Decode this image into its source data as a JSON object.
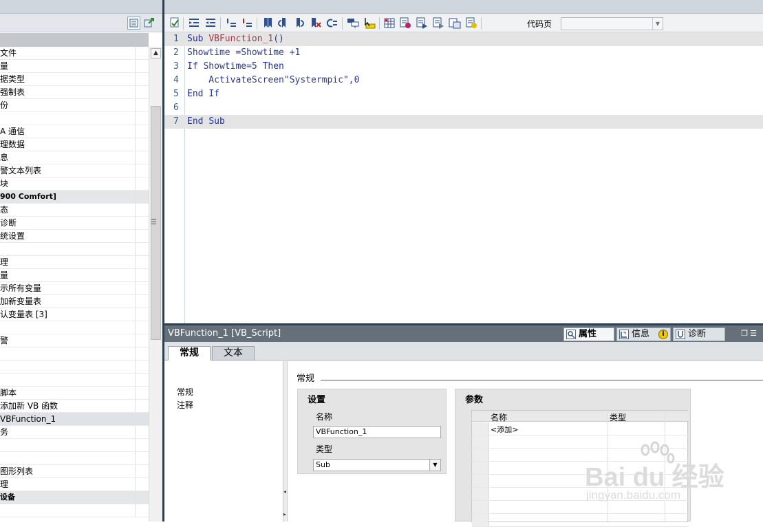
{
  "project_tree": {
    "rows": [
      {
        "label": "文件",
        "bold": false,
        "selected": false
      },
      {
        "label": "量",
        "bold": false,
        "selected": false
      },
      {
        "label": "据类型",
        "bold": false,
        "selected": false
      },
      {
        "label": "强制表",
        "bold": false,
        "selected": false
      },
      {
        "label": "份",
        "bold": false,
        "selected": false
      },
      {
        "label": "",
        "bold": false,
        "selected": false
      },
      {
        "label": "A 通信",
        "bold": false,
        "selected": false
      },
      {
        "label": "理数据",
        "bold": false,
        "selected": false
      },
      {
        "label": "息",
        "bold": false,
        "selected": false
      },
      {
        "label": "警文本列表",
        "bold": false,
        "selected": false
      },
      {
        "label": "块",
        "bold": false,
        "selected": false
      },
      {
        "label": "900 Comfort]",
        "bold": true,
        "selected": false
      },
      {
        "label": "态",
        "bold": false,
        "selected": false
      },
      {
        "label": "诊断",
        "bold": false,
        "selected": false
      },
      {
        "label": "统设置",
        "bold": false,
        "selected": false
      },
      {
        "label": "",
        "bold": false,
        "selected": false
      },
      {
        "label": "理",
        "bold": false,
        "selected": false
      },
      {
        "label": "量",
        "bold": false,
        "selected": false
      },
      {
        "label": "示所有变量",
        "bold": false,
        "selected": false
      },
      {
        "label": "加新变量表",
        "bold": false,
        "selected": false
      },
      {
        "label": "认变量表 [3]",
        "bold": false,
        "selected": false
      },
      {
        "label": "",
        "bold": false,
        "selected": false
      },
      {
        "label": "警",
        "bold": false,
        "selected": false
      },
      {
        "label": "",
        "bold": false,
        "selected": false
      },
      {
        "label": "",
        "bold": false,
        "selected": false
      },
      {
        "label": "",
        "bold": false,
        "selected": false
      },
      {
        "label": "脚本",
        "bold": false,
        "selected": false
      },
      {
        "label": "添加新 VB 函数",
        "bold": false,
        "selected": false
      },
      {
        "label": "VBFunction_1",
        "bold": false,
        "selected": true
      },
      {
        "label": "务",
        "bold": false,
        "selected": false
      },
      {
        "label": "",
        "bold": false,
        "selected": false
      },
      {
        "label": "",
        "bold": false,
        "selected": false
      },
      {
        "label": "图形列表",
        "bold": false,
        "selected": false
      },
      {
        "label": "理",
        "bold": false,
        "selected": false
      },
      {
        "label": "设备",
        "bold": true,
        "selected": false
      },
      {
        "label": "",
        "bold": false,
        "selected": false
      }
    ]
  },
  "toolbar": {
    "codepage_label": "代码页",
    "codepage_value": "",
    "buttons": [
      "compile-icon",
      "indent-icon",
      "outdent-icon",
      "comment-icon",
      "uncomment-icon",
      "bookmark-icon",
      "prev-bookmark-icon",
      "next-bookmark-icon",
      "clear-bookmarks-icon",
      "goto-icon",
      "object-list-icon",
      "highlight-icon",
      "grid-icon",
      "snippet1-icon",
      "snippet2-icon",
      "snippet3-icon",
      "snippet4-icon",
      "snippet5-icon"
    ]
  },
  "code": {
    "lines": [
      {
        "n": "1",
        "text": "Sub VBFunction_1()",
        "hl": true
      },
      {
        "n": "2",
        "text": "Showtime =Showtime +1",
        "hl": false
      },
      {
        "n": "3",
        "text": "If Showtime=5 Then",
        "hl": false
      },
      {
        "n": "4",
        "text": "    ActivateScreen\"Systermpic\",0",
        "hl": false
      },
      {
        "n": "5",
        "text": "End If",
        "hl": false
      },
      {
        "n": "6",
        "text": "",
        "hl": false
      },
      {
        "n": "7",
        "text": "End Sub",
        "hl": true
      }
    ]
  },
  "inspector": {
    "title": "VBFunction_1 [VB_Script]",
    "tab_properties": "属性",
    "tab_info": "信息",
    "tab_diagnostics": "诊断",
    "page_tab_general": "常规",
    "page_tab_text": "文本",
    "nav_general": "常规",
    "nav_comment": "注释",
    "section_title": "常规",
    "settings": {
      "title": "设置",
      "name_label": "名称",
      "name_value": "VBFunction_1",
      "type_label": "类型",
      "type_value": "Sub"
    },
    "params": {
      "title": "参数",
      "col_name": "名称",
      "col_type": "类型",
      "add_row": "<添加>"
    }
  },
  "colors": {
    "keyword": "#1a2fb0",
    "function_name": "#9a3a4a",
    "splitter": "#2c3e50",
    "title_bar": "#65707a"
  },
  "watermark": {
    "brand": "Bai du 经验",
    "url": "jingyan.baidu.com"
  }
}
